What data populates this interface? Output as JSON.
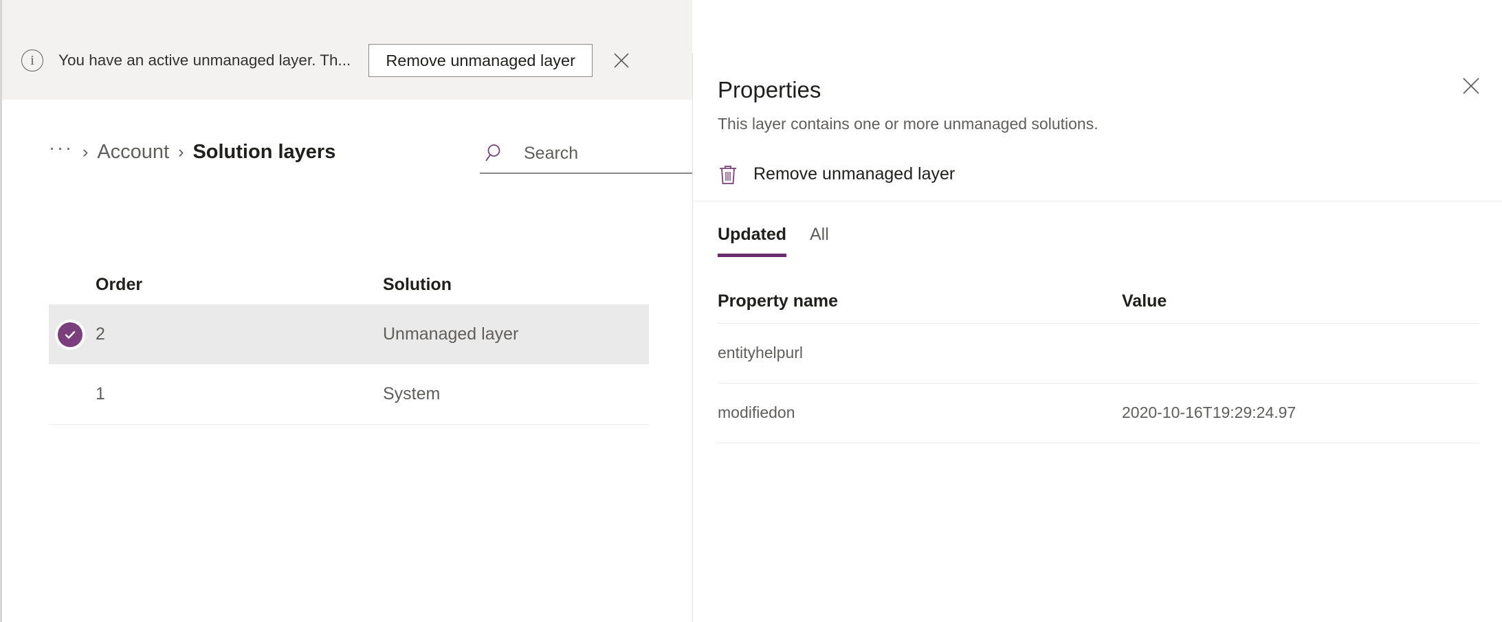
{
  "message_bar": {
    "icon": "info-circle-icon",
    "text": "You have an active unmanaged layer. Th...",
    "action_label": "Remove unmanaged layer",
    "dismiss_icon": "close-icon"
  },
  "breadcrumb": {
    "overflow": "···",
    "separator": "›",
    "parent": "Account",
    "current": "Solution layers"
  },
  "search": {
    "icon": "search-icon",
    "placeholder": "Search",
    "value": ""
  },
  "layers_table": {
    "columns": [
      "Order",
      "Solution"
    ],
    "rows": [
      {
        "order": "2",
        "solution": "Unmanaged layer",
        "selected": true
      },
      {
        "order": "1",
        "solution": "System",
        "selected": false
      }
    ]
  },
  "properties_panel": {
    "title": "Properties",
    "subtitle": "This layer contains one or more unmanaged solutions.",
    "close_icon": "close-icon",
    "command": {
      "icon": "trash-icon",
      "label": "Remove unmanaged layer"
    },
    "tabs": [
      {
        "label": "Updated",
        "active": true
      },
      {
        "label": "All",
        "active": false
      }
    ],
    "table": {
      "columns": [
        "Property name",
        "Value"
      ],
      "rows": [
        {
          "name": "entityhelpurl",
          "value": ""
        },
        {
          "name": "modifiedon",
          "value": "2020-10-16T19:29:24.97"
        }
      ]
    }
  },
  "colors": {
    "accent_purple": "#7b3f7d",
    "tab_underline": "#6c2a6e",
    "message_bar_bg": "#f3f2f1",
    "selected_row_bg": "#eaeaea",
    "divider": "#edebe9"
  }
}
